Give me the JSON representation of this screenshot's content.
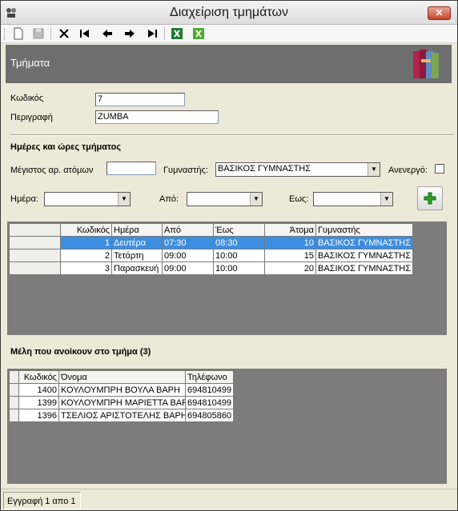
{
  "window": {
    "title": "Διαχείριση τμημάτων",
    "close_label": "✕"
  },
  "toolbar": {
    "items": [
      {
        "icon": "new-document-icon"
      },
      {
        "icon": "save-icon"
      },
      {
        "icon": "delete-icon"
      },
      {
        "icon": "first-record-icon"
      },
      {
        "icon": "previous-record-icon"
      },
      {
        "icon": "next-record-icon"
      },
      {
        "icon": "last-record-icon"
      },
      {
        "icon": "excel-export-icon"
      },
      {
        "icon": "excel-import-icon"
      }
    ]
  },
  "header": {
    "title": "Τμήματα",
    "icon": "books-icon"
  },
  "form": {
    "code_label": "Κωδικός",
    "code_value": "7",
    "description_label": "Περιγραφή",
    "description_value": "ZUMBA"
  },
  "schedule": {
    "section_title": "Ημέρες και ώρες τμήματος",
    "max_people_label": "Μέγιστος αρ. ατόμων",
    "max_people_value": "",
    "trainer_label": "Γυμναστής:",
    "trainer_value": "ΒΑΣΙΚΟΣ ΓΥΜΝΑΣΤΗΣ",
    "inactive_label": "Ανενεργό:",
    "inactive_checked": false,
    "day_label": "Ημέρα:",
    "day_value": "",
    "from_label": "Από:",
    "from_value": "",
    "to_label": "Εως:",
    "to_value": "",
    "add_icon": "plus-icon",
    "columns": [
      "Κωδικός",
      "Ημέρα",
      "Από",
      "Έως",
      "Άτομα",
      "Γυμναστής"
    ],
    "rows": [
      {
        "code": "1",
        "day": "Δευτέρα",
        "from": "07:30",
        "to": "08:30",
        "people": "10",
        "trainer": "ΒΑΣΙΚΟΣ ΓΥΜΝΑΣΤΗΣ"
      },
      {
        "code": "2",
        "day": "Τετάρτη",
        "from": "09:00",
        "to": "10:00",
        "people": "15",
        "trainer": "ΒΑΣΙΚΟΣ ΓΥΜΝΑΣΤΗΣ"
      },
      {
        "code": "3",
        "day": "Παρασκευή",
        "from": "09:00",
        "to": "10:00",
        "people": "20",
        "trainer": "ΒΑΣΙΚΟΣ ΓΥΜΝΑΣΤΗΣ"
      }
    ]
  },
  "members": {
    "section_title": "Μέλη που ανοίκουν στο τμήμα (3)",
    "columns": [
      "Κωδικός",
      "Όνομα",
      "Τηλέφωνο"
    ],
    "rows": [
      {
        "code": "1400",
        "name": "ΚΟΥΛΟΥΜΠΡΗ ΒΟΥΛΑ ΒΑΡΗ",
        "phone": "694810499"
      },
      {
        "code": "1399",
        "name": "ΚΟΥΛΟΥΜΠΡΗ ΜΑΡΙΕΤΤΑ ΒΑΡΗ",
        "phone": "694810499"
      },
      {
        "code": "1396",
        "name": "ΤΣΕΛΙΟΣ ΑΡΙΣΤΟΤΕΛΗΣ ΒΑΡΗ+Α",
        "phone": "694805860"
      }
    ]
  },
  "status": {
    "text": "Εγγραφή 1 απο 1"
  }
}
